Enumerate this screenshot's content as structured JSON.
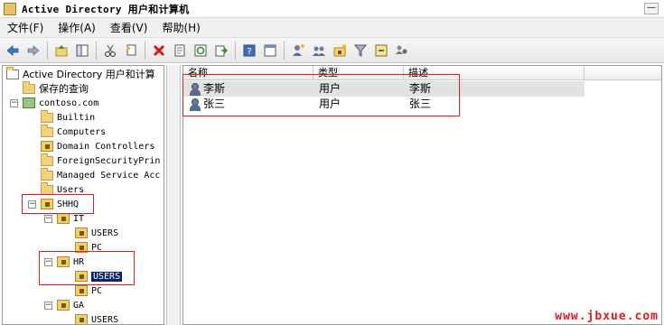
{
  "window": {
    "title": "Active Directory 用户和计算机",
    "min_symbol": "—"
  },
  "menu": [
    {
      "label": "文件(F)"
    },
    {
      "label": "操作(A)"
    },
    {
      "label": "查看(V)"
    },
    {
      "label": "帮助(H)"
    }
  ],
  "toolbar_icons": [
    "back-icon",
    "forward-icon",
    "up-icon",
    "show-tree-icon",
    "cut-icon",
    "copy-icon",
    "delete-icon",
    "properties-icon",
    "refresh-icon",
    "export-icon",
    "help-icon",
    "console-icon",
    "new-user-icon",
    "new-group-icon",
    "new-ou-icon",
    "filter-icon",
    "find-icon",
    "add-to-group-icon"
  ],
  "tree": {
    "root": "Active Directory 用户和计算",
    "saved_queries": "保存的查询",
    "domain": "contoso.com",
    "containers": [
      "Builtin",
      "Computers",
      "Domain Controllers",
      "ForeignSecurityPrin",
      "Managed Service Acc",
      "Users"
    ],
    "shhq": "SHHQ",
    "it": "IT",
    "it_children": [
      "USERS",
      "PC"
    ],
    "hr": "HR",
    "hr_children": [
      "USERS",
      "PC"
    ],
    "ga": "GA",
    "ga_children": [
      "USERS"
    ]
  },
  "list": {
    "columns": [
      "名称",
      "类型",
      "描述"
    ],
    "rows": [
      {
        "name": "李斯",
        "type": "用户",
        "description": "李斯"
      },
      {
        "name": "张三",
        "type": "用户",
        "description": "张三"
      }
    ]
  },
  "watermark": "www.jbxue.com",
  "colors": {
    "annotation": "#e01b24",
    "selection": "#0a246a",
    "folder": "#f2d27a"
  }
}
